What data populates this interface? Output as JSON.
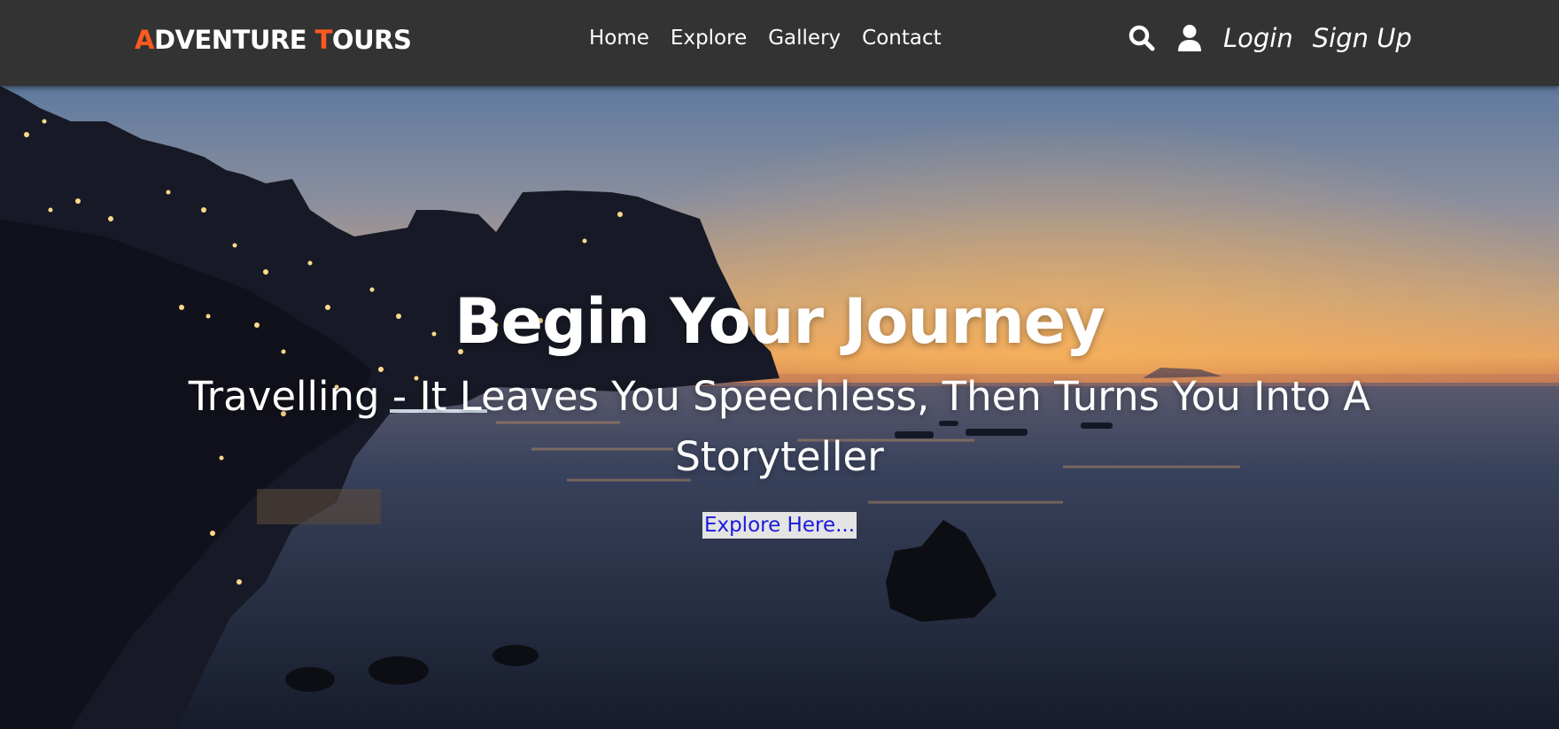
{
  "nav": {
    "logo": {
      "first_letter": "A",
      "first_rest": "DVENTURE ",
      "second_letter": "T",
      "second_rest": "OURS"
    },
    "links": [
      "Home",
      "Explore",
      "Gallery",
      "Contact"
    ],
    "icons": [
      "search-icon",
      "user-icon"
    ],
    "login_label": "Login",
    "signup_label": "Sign Up"
  },
  "hero": {
    "title": "Begin Your Journey",
    "subtitle": "Travelling - It Leaves You Speechless, Then Turns You Into A Storyteller",
    "button_label": "Explore Here..."
  },
  "colors": {
    "navbar": "#333333",
    "logo_accent": "#ff5a1f",
    "text": "#ffffff",
    "button_bg": "#e4e4e4",
    "button_text": "#1a1adb"
  }
}
